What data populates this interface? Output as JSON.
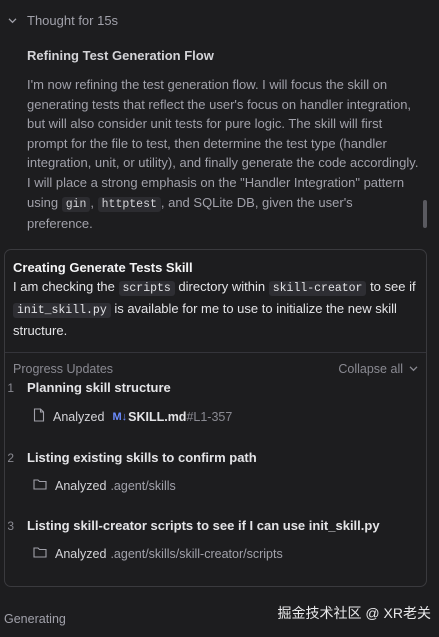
{
  "thought": {
    "header": "Thought for 15s",
    "title": "Refining Test Generation Flow",
    "paragraph_part1": "I'm now refining the test generation flow. I will focus the skill on generating tests that reflect the user's focus on handler integration, but will also consider unit tests for pure logic. The skill will first prompt for the file to test, then determine the test type (handler integration, unit, or utility), and finally generate the code accordingly. I will place a strong emphasis on the \"Handler Integration\" pattern using ",
    "code1": "gin",
    "sep1": ", ",
    "code2": "httptest",
    "paragraph_part2": ", and SQLite DB, given the user's preference."
  },
  "task": {
    "title": "Creating Generate Tests Skill",
    "desc_part1": "I am checking the ",
    "code1": "scripts",
    "desc_part2": " directory within ",
    "code2": "skill-creator",
    "desc_part3": " to see if ",
    "code3": "init_skill.py",
    "desc_part4": " is available for me to use to initialize the new skill structure."
  },
  "progress": {
    "label": "Progress Updates",
    "collapse_label": "Collapse all",
    "steps": [
      {
        "num": "1",
        "title": "Planning skill structure",
        "verb": "Analyzed",
        "badge": "M↓",
        "file": "SKILL.md",
        "range": "#L1-357",
        "icon": "file-icon"
      },
      {
        "num": "2",
        "title": "Listing existing skills to confirm path",
        "verb": "Analyzed",
        "path": ".agent/skills",
        "icon": "folder-icon"
      },
      {
        "num": "3",
        "title": "Listing skill-creator scripts to see if I can use init_skill.py",
        "verb": "Analyzed",
        "path": ".agent/skills/skill-creator/scripts",
        "icon": "folder-icon"
      }
    ]
  },
  "status": "Generating",
  "watermark": "掘金技术社区 @ XR老关",
  "colors": {
    "background": "#1d1d1f",
    "card_border": "#3a3a3e",
    "markdown_badge": "#6b8cff"
  }
}
